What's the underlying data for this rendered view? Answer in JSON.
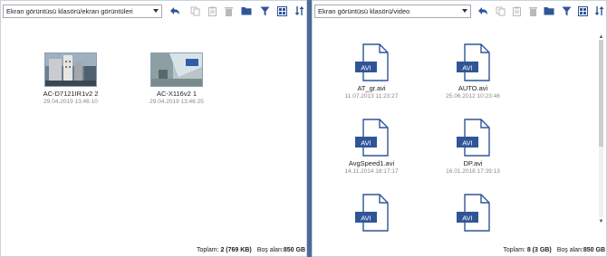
{
  "left_pane": {
    "path_select": {
      "value": "Ekran görüntüsü klasörü/ekran görüntüleri"
    },
    "toolbar_icons": [
      "back-icon",
      "copy-icon",
      "paste-icon",
      "delete-icon",
      "new-folder-icon",
      "filter-icon",
      "view-mode-icon",
      "sort-icon"
    ],
    "items": [
      {
        "name": "AC-D7121IR1v2 2",
        "date": "29.04.2019 13:46:10",
        "kind": "image-thumbnail"
      },
      {
        "name": "AC-X116v2 1",
        "date": "29.04.2019 13:46:25",
        "kind": "image-thumbnail"
      }
    ],
    "status": {
      "total_label": "Toplam:",
      "total_value": "2 (769 KB)",
      "free_label": "Boş alan:",
      "free_value": "850 GB"
    }
  },
  "right_pane": {
    "path_select": {
      "value": "Ekran görüntüsü klasörü/video"
    },
    "toolbar_icons": [
      "back-icon",
      "copy-icon",
      "paste-icon",
      "delete-icon",
      "new-folder-icon",
      "filter-icon",
      "view-mode-icon",
      "sort-icon"
    ],
    "file_icon_label": "AVI",
    "items": [
      {
        "name": "AT_gr.avi",
        "date": "11.07.2013 11:23:27"
      },
      {
        "name": "AUTO.avi",
        "date": "25.06.2012 10:23:46"
      },
      {
        "name": "AvgSpeed1.avi",
        "date": "14.11.2014 18:17:17"
      },
      {
        "name": "DP.avi",
        "date": "16.01.2018 17:39:13"
      },
      {
        "name": "",
        "date": ""
      },
      {
        "name": "",
        "date": ""
      }
    ],
    "status": {
      "total_label": "Toplam:",
      "total_value": "8 (3 GB)",
      "free_label": "Boş alan:",
      "free_value": "850 GB"
    },
    "scrollbar": {
      "position_fraction": 0.0,
      "visible_fraction": 0.6
    }
  },
  "colors": {
    "divider": "#4d6b96",
    "icon_blue": "#2f5597",
    "avi_badge": "#2f5597",
    "disabled_icon": "#b8b8b8"
  }
}
